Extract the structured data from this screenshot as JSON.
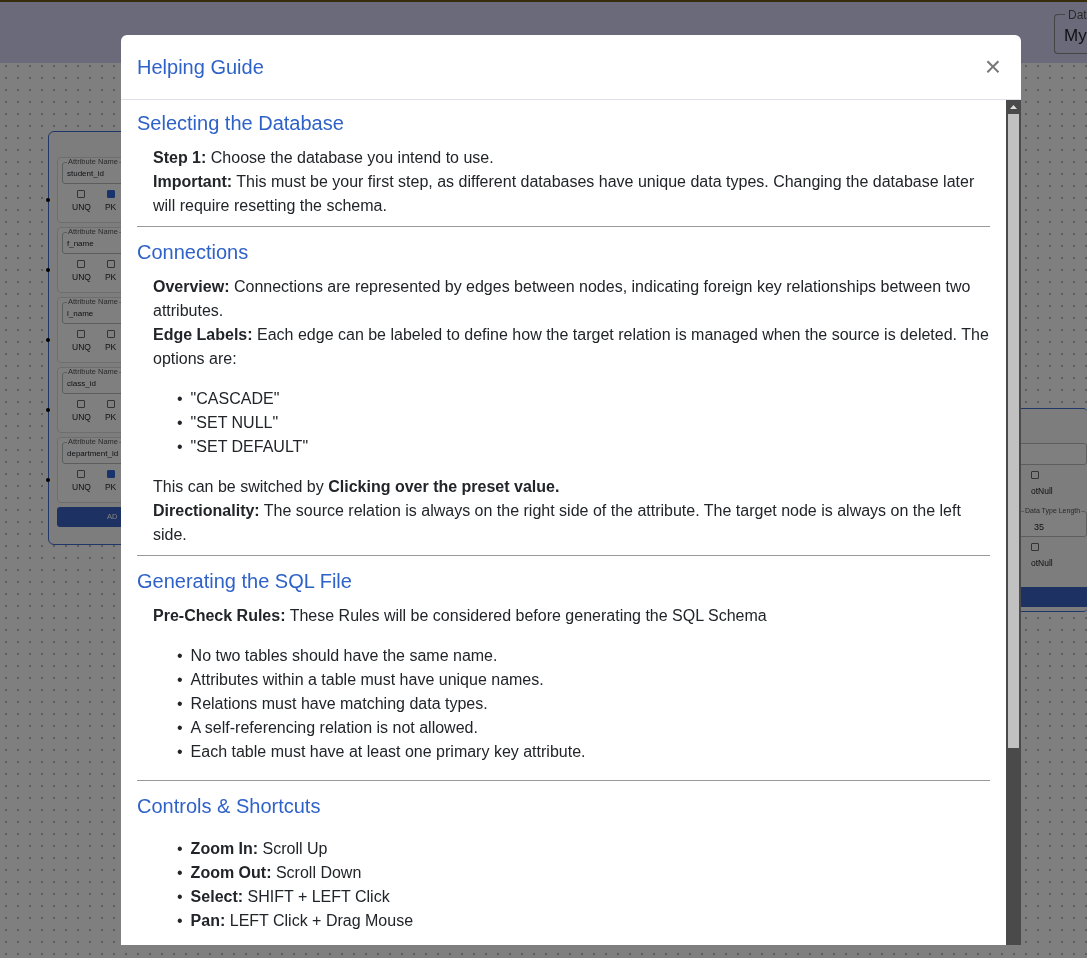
{
  "app": {
    "db_field": {
      "label": "Dat",
      "value": "My"
    }
  },
  "left_node": {
    "attributes": [
      {
        "label": "Attribute Name",
        "name": "student_id",
        "unq": {
          "label": "UNQ",
          "checked": false
        },
        "pk": {
          "label": "PK",
          "checked": true
        }
      },
      {
        "label": "Attribute Name",
        "name": "f_name",
        "unq": {
          "label": "UNQ",
          "checked": false
        },
        "pk": {
          "label": "PK",
          "checked": false
        }
      },
      {
        "label": "Attribute Name",
        "name": "l_name",
        "unq": {
          "label": "UNQ",
          "checked": false
        },
        "pk": {
          "label": "PK",
          "checked": false
        }
      },
      {
        "label": "Attribute Name",
        "name": "class_id",
        "unq": {
          "label": "UNQ",
          "checked": false
        },
        "pk": {
          "label": "PK",
          "checked": false
        }
      },
      {
        "label": "Attribute Name",
        "name": "department_id",
        "unq": {
          "label": "UNQ",
          "checked": false
        },
        "pk": {
          "label": "PK",
          "checked": true
        }
      }
    ],
    "add_button": "AD"
  },
  "right_node": {
    "rows": [
      {
        "kind": "select"
      },
      {
        "kind": "check",
        "label": "otNull",
        "checked": false
      },
      {
        "kind": "field",
        "label": "Data Type Length",
        "value": "35"
      },
      {
        "kind": "check",
        "label": "otNull",
        "checked": false
      },
      {
        "kind": "button"
      }
    ]
  },
  "modal": {
    "title": "Helping Guide",
    "close": "×",
    "sections": [
      {
        "title": "Selecting the Database",
        "blocks": [
          {
            "kind": "para",
            "text": "**Step 1:** Choose the database you intend to use."
          },
          {
            "kind": "para",
            "text": "**Important:** This must be your first step, as different databases have unique data types. Changing the database later will require resetting the schema."
          }
        ]
      },
      {
        "title": "Connections",
        "blocks": [
          {
            "kind": "para",
            "text": "**Overview:** Connections are represented by edges between nodes, indicating foreign key relationships between two attributes."
          },
          {
            "kind": "para",
            "text": "**Edge Labels:** Each edge can be labeled to define how the target relation is managed when the source is deleted. The options are:"
          },
          {
            "kind": "list",
            "marker": "•",
            "items": [
              "\"CASCADE\"",
              "\"SET NULL\"",
              "\"SET DEFAULT\""
            ]
          },
          {
            "kind": "para",
            "text": "This can be switched by **Clicking over the preset value.**"
          },
          {
            "kind": "para",
            "text": "**Directionality:** The source relation is always on the right side of the attribute. The target node is always on the left side."
          }
        ]
      },
      {
        "title": "Generating the SQL File",
        "blocks": [
          {
            "kind": "para",
            "text": "**Pre-Check Rules:** These Rules will be considered before generating the SQL Schema"
          },
          {
            "kind": "list",
            "marker": "•",
            "items": [
              "No two tables should have the same name.",
              "Attributes within a table must have unique names.",
              "Relations must have matching data types.",
              "A self-referencing relation is not allowed.",
              "Each table must have at least one primary key attribute."
            ]
          }
        ]
      },
      {
        "title": "Controls & Shortcuts",
        "blocks": [
          {
            "kind": "list",
            "marker": "•",
            "items": [
              "**Zoom In:** Scroll Up",
              "**Zoom Out:** Scroll Down",
              "**Select:** SHIFT + LEFT Click",
              "**Pan:** LEFT Click + Drag Mouse"
            ]
          }
        ]
      }
    ]
  }
}
